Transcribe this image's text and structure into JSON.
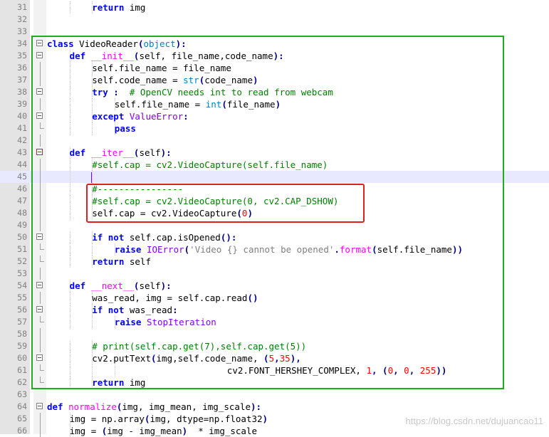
{
  "editor": {
    "watermark": "https://blog.csdn.net/dujuancao11",
    "colors": {
      "highlight_box_green": "#22aa22",
      "highlight_box_red": "#e02020",
      "current_line": "#e8e8ff",
      "caret": "#8000ff"
    },
    "lines": [
      {
        "n": "31",
        "indent": 2,
        "fold": "none",
        "segs": [
          [
            "kw",
            "return"
          ],
          [
            "",
            "img"
          ]
        ]
      },
      {
        "n": "32",
        "indent": 0,
        "fold": "none",
        "segs": []
      },
      {
        "n": "33",
        "indent": 0,
        "fold": "none",
        "segs": []
      },
      {
        "n": "34",
        "indent": 0,
        "fold": "box",
        "segs": [
          [
            "kw",
            "class"
          ],
          [
            "",
            "VideoReader"
          ],
          [
            "op",
            "("
          ],
          [
            "bi",
            "object"
          ],
          [
            "op",
            "):"
          ]
        ]
      },
      {
        "n": "35",
        "indent": 1,
        "fold": "box",
        "segs": [
          [
            "kw",
            "def"
          ],
          [
            "fn",
            "__init__"
          ],
          [
            "op",
            "("
          ],
          [
            "",
            "self, file_name,code_name"
          ],
          [
            "op",
            "):"
          ]
        ]
      },
      {
        "n": "36",
        "indent": 2,
        "fold": "line",
        "segs": [
          [
            "",
            "self.file_name = file_name"
          ]
        ]
      },
      {
        "n": "37",
        "indent": 2,
        "fold": "line",
        "segs": [
          [
            "",
            "self.code_name = "
          ],
          [
            "bi",
            "str"
          ],
          [
            "op",
            "("
          ],
          [
            "",
            "code_name"
          ],
          [
            "op",
            ")"
          ]
        ]
      },
      {
        "n": "38",
        "indent": 2,
        "fold": "box",
        "segs": [
          [
            "kw",
            "try"
          ],
          [
            "op",
            ":"
          ],
          [
            "cm",
            "  # OpenCV needs int to read from webcam"
          ]
        ]
      },
      {
        "n": "39",
        "indent": 3,
        "fold": "line",
        "segs": [
          [
            "",
            "self.file_name = "
          ],
          [
            "bi",
            "int"
          ],
          [
            "op",
            "("
          ],
          [
            "",
            "file_name"
          ],
          [
            "op",
            ")"
          ]
        ]
      },
      {
        "n": "40",
        "indent": 2,
        "fold": "box",
        "segs": [
          [
            "kw",
            "except"
          ],
          [
            "exc",
            "ValueError"
          ],
          [
            "op",
            ":"
          ]
        ]
      },
      {
        "n": "41",
        "indent": 3,
        "fold": "end",
        "segs": [
          [
            "kw",
            "pass"
          ]
        ]
      },
      {
        "n": "42",
        "indent": 0,
        "fold": "line",
        "segs": []
      },
      {
        "n": "43",
        "indent": 1,
        "fold": "redbox",
        "segs": [
          [
            "kw",
            "def"
          ],
          [
            "fn",
            "__iter__"
          ],
          [
            "op",
            "("
          ],
          [
            "",
            "self"
          ],
          [
            "op",
            "):"
          ]
        ]
      },
      {
        "n": "44",
        "indent": 2,
        "fold": "line",
        "segs": [
          [
            "cm",
            "#self.cap = cv2.VideoCapture(self.file_name)"
          ]
        ]
      },
      {
        "n": "45",
        "indent": 2,
        "fold": "line",
        "cur": true,
        "segs": []
      },
      {
        "n": "46",
        "indent": 2,
        "fold": "line",
        "segs": [
          [
            "cm",
            "#----------------"
          ]
        ]
      },
      {
        "n": "47",
        "indent": 2,
        "fold": "line",
        "segs": [
          [
            "cm",
            "#self.cap = cv2.VideoCapture(0, cv2.CAP_DSHOW)"
          ]
        ]
      },
      {
        "n": "48",
        "indent": 2,
        "fold": "line",
        "segs": [
          [
            "",
            "self.cap = cv2.VideoCapture"
          ],
          [
            "op",
            "("
          ],
          [
            "num",
            "0"
          ],
          [
            "op",
            ")"
          ]
        ]
      },
      {
        "n": "49",
        "indent": 0,
        "fold": "line",
        "segs": []
      },
      {
        "n": "50",
        "indent": 2,
        "fold": "box",
        "segs": [
          [
            "kw",
            "if not"
          ],
          [
            "",
            "self.cap.isOpened"
          ],
          [
            "op",
            "():"
          ]
        ]
      },
      {
        "n": "51",
        "indent": 3,
        "fold": "end",
        "segs": [
          [
            "kw",
            "raise"
          ],
          [
            "exc",
            "IOError"
          ],
          [
            "op",
            "("
          ],
          [
            "st",
            "'Video {} cannot be opened'"
          ],
          [
            "op",
            "."
          ],
          [
            "fn",
            "format"
          ],
          [
            "op",
            "("
          ],
          [
            "",
            "self.file_name"
          ],
          [
            "op",
            "))"
          ]
        ]
      },
      {
        "n": "52",
        "indent": 2,
        "fold": "end",
        "segs": [
          [
            "kw",
            "return"
          ],
          [
            "",
            "self"
          ]
        ]
      },
      {
        "n": "53",
        "indent": 0,
        "fold": "line",
        "segs": []
      },
      {
        "n": "54",
        "indent": 1,
        "fold": "box",
        "segs": [
          [
            "kw",
            "def"
          ],
          [
            "fn",
            "__next__"
          ],
          [
            "op",
            "("
          ],
          [
            "",
            "self"
          ],
          [
            "op",
            "):"
          ]
        ]
      },
      {
        "n": "55",
        "indent": 2,
        "fold": "line",
        "segs": [
          [
            "",
            "was_read, img = self.cap.read"
          ],
          [
            "op",
            "()"
          ]
        ]
      },
      {
        "n": "56",
        "indent": 2,
        "fold": "box",
        "segs": [
          [
            "kw",
            "if not"
          ],
          [
            "",
            "was_read"
          ],
          [
            "op",
            ":"
          ]
        ]
      },
      {
        "n": "57",
        "indent": 3,
        "fold": "end",
        "segs": [
          [
            "kw",
            "raise"
          ],
          [
            "exc",
            "StopIteration"
          ]
        ]
      },
      {
        "n": "58",
        "indent": 0,
        "fold": "line",
        "segs": []
      },
      {
        "n": "59",
        "indent": 2,
        "fold": "line",
        "segs": [
          [
            "cm",
            "# print(self.cap.get(7),self.cap.get(5))"
          ]
        ]
      },
      {
        "n": "60",
        "indent": 2,
        "fold": "box",
        "segs": [
          [
            "",
            "cv2.putText"
          ],
          [
            "op",
            "("
          ],
          [
            "",
            "img,self.code_name, "
          ],
          [
            "op",
            "("
          ],
          [
            "num",
            "5"
          ],
          [
            "op",
            ","
          ],
          [
            "num",
            "35"
          ],
          [
            "op",
            "),"
          ]
        ]
      },
      {
        "n": "61",
        "indent": 8,
        "fold": "end",
        "segs": [
          [
            "",
            "cv2.FONT_HERSHEY_COMPLEX, "
          ],
          [
            "num",
            "1"
          ],
          [
            "op",
            ", ("
          ],
          [
            "num",
            "0"
          ],
          [
            "op",
            ", "
          ],
          [
            "num",
            "0"
          ],
          [
            "op",
            ", "
          ],
          [
            "num",
            "255"
          ],
          [
            "op",
            "))"
          ]
        ]
      },
      {
        "n": "62",
        "indent": 2,
        "fold": "end",
        "segs": [
          [
            "kw",
            "return"
          ],
          [
            "",
            "img"
          ]
        ]
      },
      {
        "n": "63",
        "indent": 0,
        "fold": "none",
        "segs": []
      },
      {
        "n": "64",
        "indent": 0,
        "fold": "box",
        "segs": [
          [
            "kw",
            "def"
          ],
          [
            "fn",
            "normalize"
          ],
          [
            "op",
            "("
          ],
          [
            "",
            "img, img_mean, img_scale"
          ],
          [
            "op",
            "):"
          ]
        ]
      },
      {
        "n": "65",
        "indent": 1,
        "fold": "line",
        "segs": [
          [
            "",
            "img = np.array"
          ],
          [
            "op",
            "("
          ],
          [
            "",
            "img, dtype=np.float32"
          ],
          [
            "op",
            ")"
          ]
        ]
      },
      {
        "n": "66",
        "indent": 1,
        "fold": "line",
        "segs": [
          [
            "",
            "img = "
          ],
          [
            "op",
            "("
          ],
          [
            "",
            "img - img_mean"
          ],
          [
            "op",
            ")"
          ],
          [
            "",
            "  * img_scale"
          ]
        ]
      }
    ]
  }
}
